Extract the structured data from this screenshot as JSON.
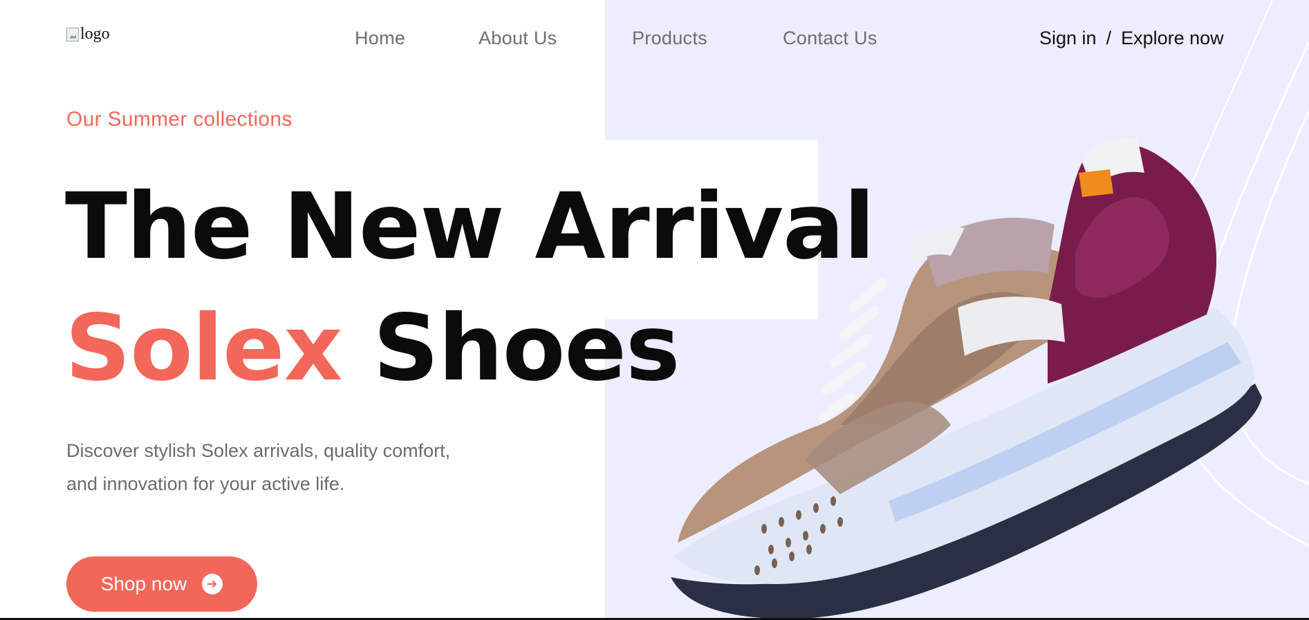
{
  "header": {
    "logo_alt": "logo",
    "nav": [
      "Home",
      "About Us",
      "Products",
      "Contact Us"
    ],
    "sign_in": "Sign in",
    "separator": "/",
    "explore": "Explore now"
  },
  "hero": {
    "eyebrow": "Our Summer collections",
    "headline_line1": "The New Arrival",
    "headline_accent": "Solex",
    "headline_rest": "Shoes",
    "description": "Discover stylish Solex arrivals, quality comfort, and innovation for your active life.",
    "cta_label": "Shop now",
    "cta_icon": "arrow-right-circle-icon"
  },
  "colors": {
    "accent": "#f3675a",
    "panel": "#ecedfe",
    "text_dark": "#0b0b0b",
    "text_muted": "#6b6b6b"
  },
  "image": {
    "subject": "sneaker-product-image"
  }
}
